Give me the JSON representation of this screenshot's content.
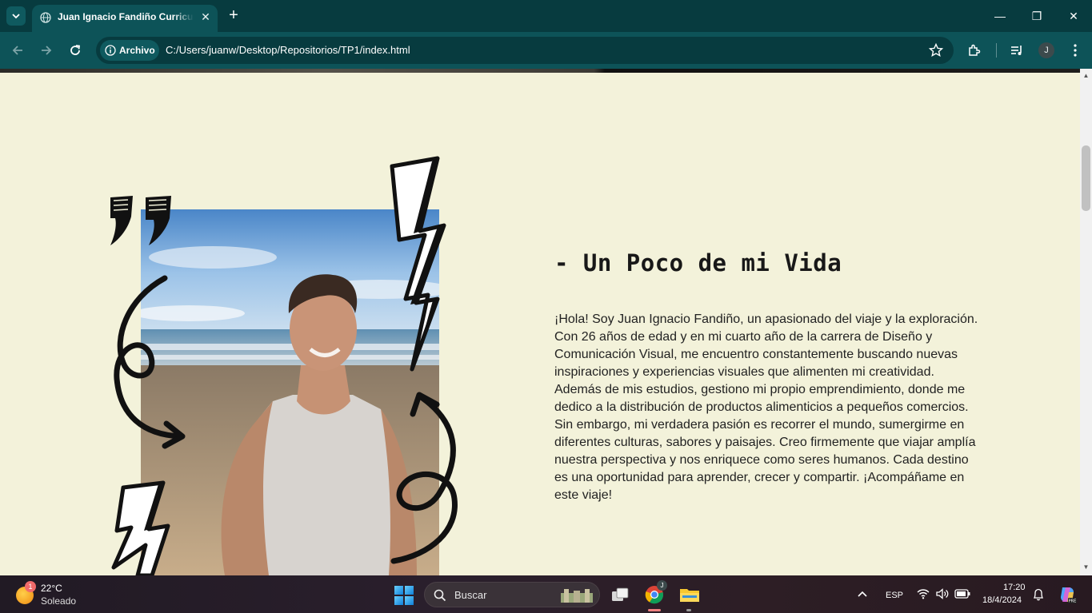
{
  "browser": {
    "tab_title": "Juan Ignacio Fandiño Curriculum",
    "address_chip": "Archivo",
    "url": "C:/Users/juanw/Desktop/Repositorios/TP1/index.html",
    "profile_initial": "J"
  },
  "page": {
    "heading": "- Un Poco de mi Vida",
    "bio": "¡Hola! Soy Juan Ignacio Fandiño, un apasionado del viaje y la exploración. Con 26 años de edad y en mi cuarto año de la carrera de Diseño y Comunicación Visual, me encuentro constantemente buscando nuevas inspiraciones y experiencias visuales que alimenten mi creatividad. Además de mis estudios, gestiono mi propio emprendimiento, donde me dedico a la distribución de productos alimenticios a pequeños comercios. Sin embargo, mi verdadera pasión es recorrer el mundo, sumergirme en diferentes culturas, sabores y paisajes. Creo firmemente que viajar amplía nuestra perspectiva y nos enriquece como seres humanos. Cada destino es una oportunidad para aprender, crecer y compartir. ¡Acompáñame en este viaje!",
    "background_color": "#f3f2da"
  },
  "taskbar": {
    "weather_badge": "1",
    "temperature": "22°C",
    "condition": "Soleado",
    "search_placeholder": "Buscar",
    "chrome_badge": "J",
    "language": "ESP",
    "time": "17:20",
    "date": "18/4/2024"
  },
  "colors": {
    "tab_bar": "#073b3f",
    "toolbar": "#0d5358"
  }
}
